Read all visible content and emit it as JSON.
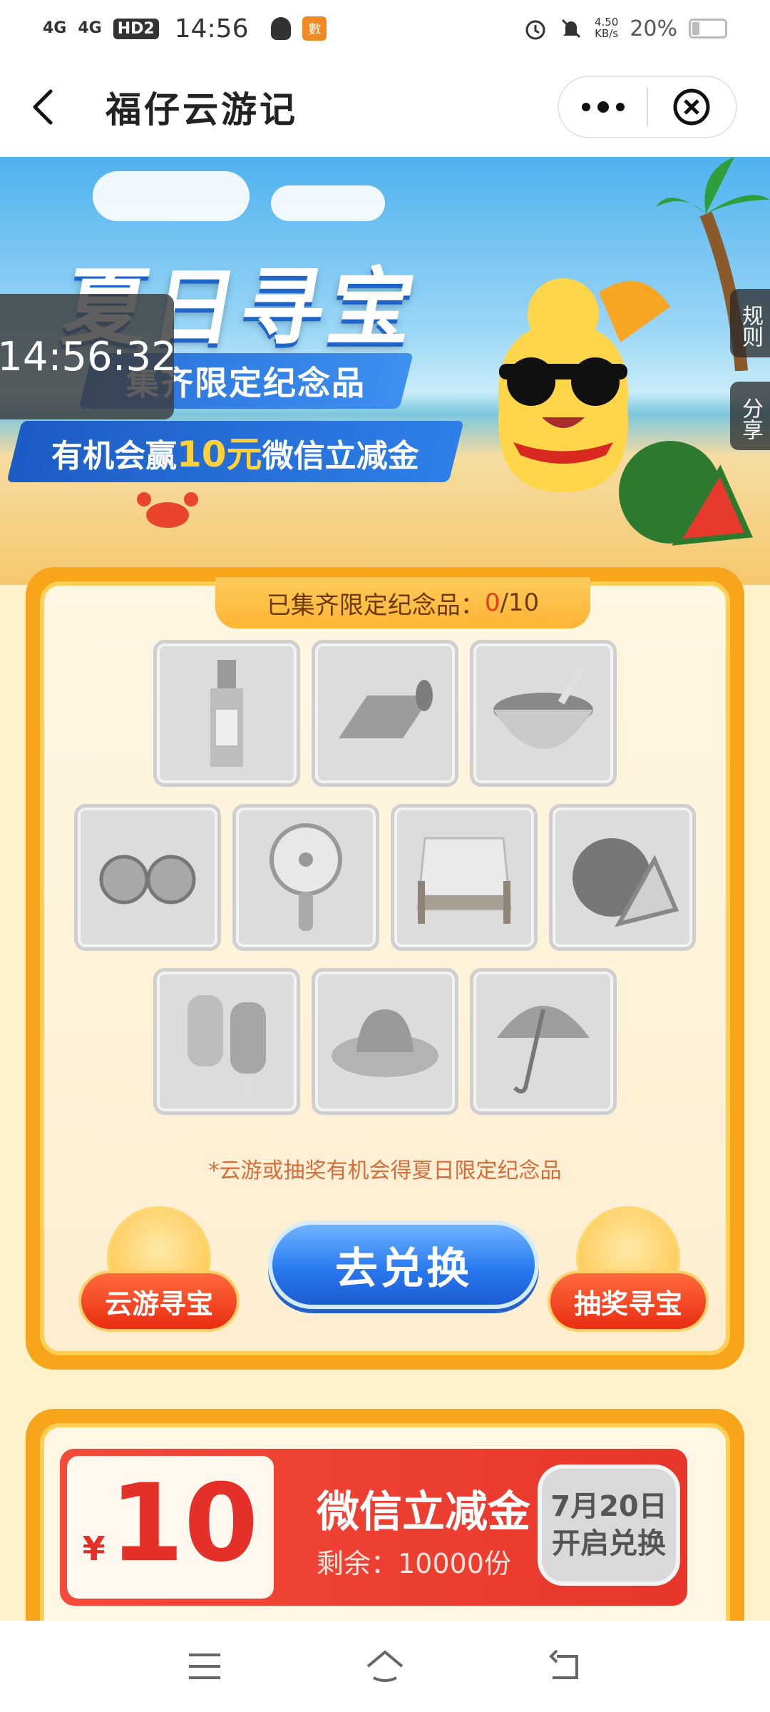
{
  "status": {
    "signal1": "4G",
    "signal2": "4G",
    "hd": "HD2",
    "time": "14:56",
    "speed_value": "4.50",
    "speed_unit": "KB/s",
    "battery": "20%"
  },
  "titlebar": {
    "title": "福仔云游记"
  },
  "banner": {
    "timer": "14:56:32",
    "title": "夏日寻宝",
    "subtitle": "集齐限定纪念品",
    "promo_prefix": "有机会赢",
    "promo_amount": "10元",
    "promo_suffix": "微信立减金",
    "rules_label": "规则",
    "share_label": "分享"
  },
  "collection": {
    "label": "已集齐限定纪念品：",
    "count": "0",
    "total": "/10",
    "items": [
      "bottle",
      "mat",
      "porridge",
      "sunglasses",
      "fan",
      "bed",
      "watermelon",
      "popsicle",
      "hat",
      "umbrella"
    ],
    "hint": "*云游或抽奖有机会得夏日限定纪念品",
    "left_action": "云游寻宝",
    "redeem": "去兑换",
    "right_action": "抽奖寻宝"
  },
  "coupon": {
    "currency": "¥",
    "amount": "10",
    "title": "微信立减金",
    "remain": "剩余：10000份",
    "btn_line1": "7月20日",
    "btn_line2": "开启兑换"
  },
  "colors": {
    "accent_orange": "#f9a51c",
    "redeem_blue": "#2a7af0",
    "coupon_red": "#e8362a"
  }
}
